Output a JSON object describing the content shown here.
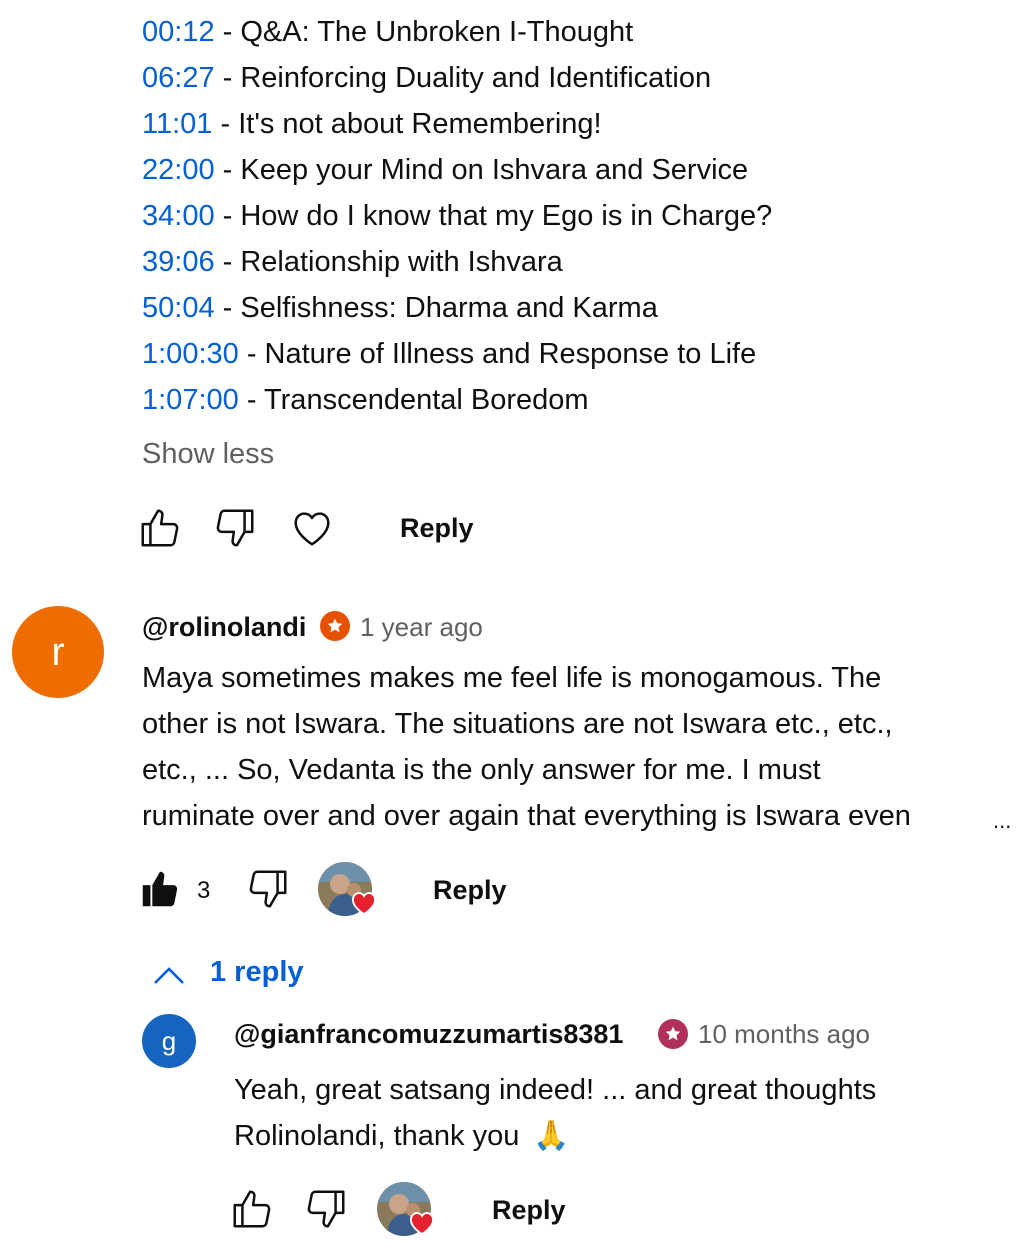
{
  "chapters": [
    {
      "time": "00:12",
      "title": "Q&A: The Unbroken I-Thought"
    },
    {
      "time": "06:27",
      "title": "Reinforcing Duality and Identification"
    },
    {
      "time": "11:01",
      "title": "It's not about Remembering!"
    },
    {
      "time": "22:00",
      "title": "Keep your Mind on Ishvara and Service"
    },
    {
      "time": "34:00",
      "title": "How do I know that my Ego is in Charge?"
    },
    {
      "time": "39:06",
      "title": "Relationship with Ishvara"
    },
    {
      "time": "50:04",
      "title": "Selfishness: Dharma and Karma"
    },
    {
      "time": "1:00:30",
      "title": "Nature of Illness and Response to Life"
    },
    {
      "time": "1:07:00",
      "title": "Transcendental Boredom"
    }
  ],
  "separator": " - ",
  "show_less": "Show less",
  "top_actions": {
    "reply_label": "Reply",
    "icons": [
      "thumbs-up-icon",
      "thumbs-down-icon",
      "heart-icon"
    ]
  },
  "comment": {
    "avatar_letter": "r",
    "avatar_color": "#ef6c00",
    "author": "@rolinolandi",
    "badge_color": "#e65100",
    "time": "1 year ago",
    "lines": [
      "Maya sometimes makes me feel life is monogamous.  The",
      "other is not Iswara.  The situations are not Iswara etc., etc.,",
      "etc., ...  So, Vedanta is the only answer for me.  I must",
      "ruminate over and over again that everything is Iswara even"
    ],
    "ellipsis": "...",
    "like_count": "3",
    "reply_label": "Reply"
  },
  "replies_toggle": {
    "label": "1 reply",
    "icon": "chevron-up-icon"
  },
  "reply": {
    "avatar_letter": "g",
    "avatar_color": "#1565c0",
    "author": "@gianfrancomuzzumartis8381",
    "badge_color": "#b0305a",
    "time": "10 months ago",
    "lines": [
      "Yeah, great satsang indeed! ... and great thoughts",
      "Rolinolandi, thank you"
    ],
    "emoji": "🙏",
    "reply_label": "Reply"
  },
  "colors": {
    "link": "#065fd4",
    "secondary_text": "#606060",
    "heart": "#e5202f"
  }
}
